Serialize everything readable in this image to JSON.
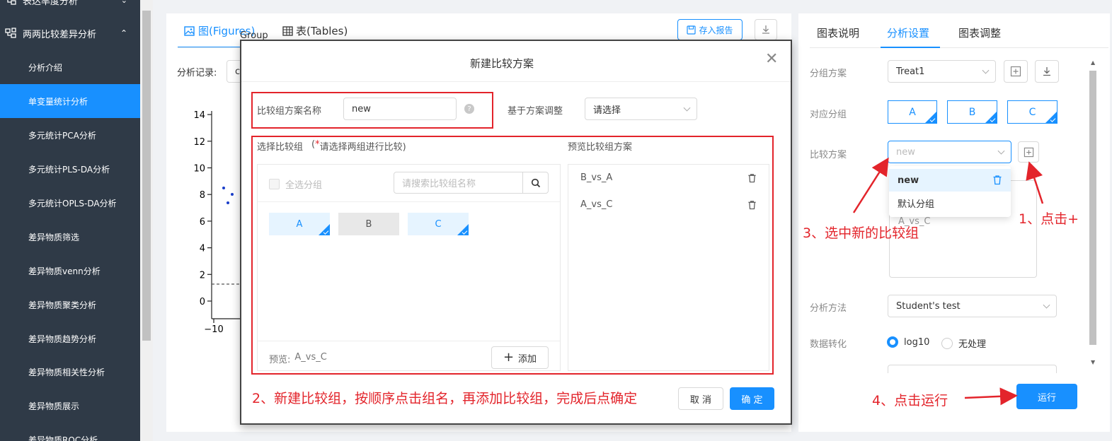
{
  "sidebar": {
    "group_top": "表达率度分析",
    "group_main": "两两比较差异分析",
    "items": [
      "分析介绍",
      "单变量统计分析",
      "多元统计PCA分析",
      "多元统计PLS-DA分析",
      "多元统计OPLS-DA分析",
      "差异物质筛选",
      "差异物质venn分析",
      "差异物质聚类分析",
      "差异物质趋势分析",
      "差异物质相关性分析",
      "差异物质展示",
      "差异物质ROC分析"
    ],
    "active_index": 1
  },
  "main": {
    "tab_figures": "图(Figures)",
    "tab_tables": "表(Tables)",
    "save_report": "存入报告",
    "record_label": "分析记录:",
    "record_value_partial": "c",
    "partial_title": "Group",
    "y_ticks": [
      "14",
      "12",
      "10",
      "8",
      "6",
      "4",
      "2",
      "0"
    ],
    "x_tick": "−10"
  },
  "modal": {
    "title": "新建比较方案",
    "name_label": "比较组方案名称",
    "name_value": "new",
    "base_label": "基于方案调整",
    "base_placeholder": "请选择",
    "select_title": "选择比较组",
    "select_hint_star": "*",
    "select_hint": "请选择两组进行比较)",
    "select_hint_open": "(",
    "select_all": "全选分组",
    "search_placeholder": "请搜索比较组名称",
    "groups": [
      {
        "name": "A",
        "selected": true
      },
      {
        "name": "B",
        "selected": false
      },
      {
        "name": "C",
        "selected": true
      }
    ],
    "preview_label": "预览:",
    "preview_value": "A_vs_C",
    "add_button": "添加",
    "preview_title": "预览比较组方案",
    "preview_items": [
      "B_vs_A",
      "A_vs_C"
    ],
    "cancel": "取 消",
    "confirm": "确 定"
  },
  "right": {
    "tabs": [
      "图表说明",
      "分析设置",
      "图表调整"
    ],
    "active_tab": 1,
    "group_scheme_label": "分组方案",
    "group_scheme_value": "Treat1",
    "corr_group_label": "对应分组",
    "corr_groups": [
      "A",
      "B",
      "C"
    ],
    "compare_label": "比较方案",
    "compare_placeholder": "new",
    "dropdown": [
      "new",
      "默认分组"
    ],
    "list_partial": "A_vs_C",
    "method_label": "分析方法",
    "method_value": "Student's test",
    "transform_label": "数据转化",
    "transform_options": [
      "log10",
      "无处理"
    ],
    "transform_selected": 0,
    "run": "运行"
  },
  "annotations": {
    "a1": "1、点击+",
    "a2": "2、新建比较组，按顺序点击组名，再添加比较组，完成后点确定",
    "a3": "3、选中新的比较组",
    "a4": "4、点击运行"
  },
  "colors": {
    "accent": "#1890ff",
    "sidebar_bg": "#2f3a47",
    "annotation": "#e3242b"
  }
}
